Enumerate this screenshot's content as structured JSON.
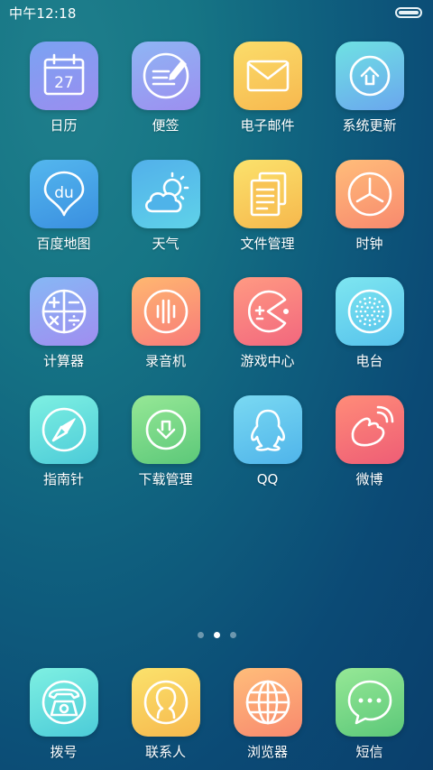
{
  "status_bar": {
    "time": "中午12:18",
    "battery_level": 1.0
  },
  "apps": [
    {
      "id": "calendar",
      "label": "日历",
      "icon": "calendar-icon",
      "date": "27",
      "colors": [
        "#7aa3f2",
        "#9b8df0"
      ]
    },
    {
      "id": "notes",
      "label": "便签",
      "icon": "notepad-pencil-icon",
      "colors": [
        "#8eb6f4",
        "#9d8ef0"
      ]
    },
    {
      "id": "email",
      "label": "电子邮件",
      "icon": "envelope-icon",
      "colors": [
        "#fbdd6a",
        "#f7b84f"
      ]
    },
    {
      "id": "system-update",
      "label": "系统更新",
      "icon": "arrow-up-circle-icon",
      "colors": [
        "#6fe2e3",
        "#6aa6ee"
      ]
    },
    {
      "id": "baidu-map",
      "label": "百度地图",
      "icon": "map-pin-du-icon",
      "colors": [
        "#54b7ee",
        "#3a8fe0"
      ]
    },
    {
      "id": "weather",
      "label": "天气",
      "icon": "cloud-sun-icon",
      "colors": [
        "#52b0ea",
        "#5fd2e9"
      ]
    },
    {
      "id": "file-manager",
      "label": "文件管理",
      "icon": "documents-icon",
      "colors": [
        "#fbe26c",
        "#f6b84d"
      ]
    },
    {
      "id": "clock",
      "label": "时钟",
      "icon": "clock-icon",
      "colors": [
        "#ffbd7a",
        "#f8896e"
      ]
    },
    {
      "id": "calculator",
      "label": "计算器",
      "icon": "calculator-icon",
      "colors": [
        "#86b8f5",
        "#a08df0"
      ]
    },
    {
      "id": "recorder",
      "label": "录音机",
      "icon": "sound-wave-icon",
      "colors": [
        "#ffb870",
        "#f87a7a"
      ]
    },
    {
      "id": "game-center",
      "label": "游戏中心",
      "icon": "pacman-icon",
      "colors": [
        "#ff9a82",
        "#f2677e"
      ]
    },
    {
      "id": "radio",
      "label": "电台",
      "icon": "radio-speaker-icon",
      "colors": [
        "#7ee6f0",
        "#56c2ec"
      ]
    },
    {
      "id": "compass",
      "label": "指南针",
      "icon": "compass-icon",
      "colors": [
        "#7ef0e2",
        "#4ccbd8"
      ]
    },
    {
      "id": "download-manager",
      "label": "下载管理",
      "icon": "arrow-down-circle-icon",
      "colors": [
        "#96e896",
        "#5cc879"
      ]
    },
    {
      "id": "qq",
      "label": "QQ",
      "icon": "qq-penguin-icon",
      "colors": [
        "#7ad9f2",
        "#4fb4ea"
      ]
    },
    {
      "id": "weibo",
      "label": "微博",
      "icon": "weibo-icon",
      "colors": [
        "#ff8c78",
        "#ee5d76"
      ]
    }
  ],
  "pagination": {
    "count": 3,
    "active": 1
  },
  "dock": [
    {
      "id": "dialer",
      "label": "拨号",
      "icon": "telephone-icon",
      "colors": [
        "#7ef0e2",
        "#4ccbd8"
      ]
    },
    {
      "id": "contacts",
      "label": "联系人",
      "icon": "person-icon",
      "colors": [
        "#fbe26c",
        "#f6b84d"
      ]
    },
    {
      "id": "browser",
      "label": "浏览器",
      "icon": "globe-icon",
      "colors": [
        "#ffbd7a",
        "#f8896e"
      ]
    },
    {
      "id": "messages",
      "label": "短信",
      "icon": "chat-bubble-icon",
      "colors": [
        "#96e896",
        "#5cc879"
      ]
    }
  ]
}
